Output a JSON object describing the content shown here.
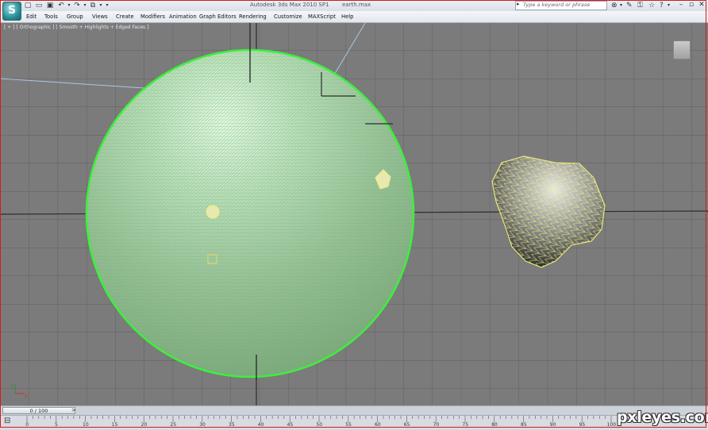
{
  "window": {
    "app_title": "Autodesk 3ds Max  2010 SP1",
    "file_name": "earth.max"
  },
  "search": {
    "placeholder": "Type a keyword or phrase"
  },
  "menu": [
    "Edit",
    "Tools",
    "Group",
    "Views",
    "Create",
    "Modifiers",
    "Animation",
    "Graph Editors",
    "Rendering",
    "Customize",
    "MAXScript",
    "Help"
  ],
  "viewport": {
    "label": "[ + ] [ Orthographic ] [ Smooth + Highlights + Edged Faces ]",
    "objects": [
      "earth-sphere",
      "asteroid-rock"
    ]
  },
  "timeline": {
    "frame_readout": "0 / 100",
    "ticks": [
      "0",
      "5",
      "10",
      "15",
      "20",
      "25",
      "30",
      "35",
      "40",
      "45",
      "50",
      "55",
      "60",
      "65",
      "70",
      "75",
      "80",
      "85",
      "90",
      "95",
      "100"
    ]
  },
  "watermark": "pxleyes.com",
  "icons": {
    "app": "3dsmax-logo",
    "quick_access": [
      "new-icon",
      "open-icon",
      "save-icon",
      "undo-icon",
      "redo-icon",
      "project-icon"
    ],
    "toolbar": [
      "binoculars-icon",
      "communication-icon",
      "key-icon",
      "star-icon",
      "help-icon"
    ]
  },
  "colors": {
    "selection": "#3cf03c",
    "grid": "#6a6a6a",
    "viewport_bg": "#7b7b7b",
    "frame": "#d21c1c"
  }
}
